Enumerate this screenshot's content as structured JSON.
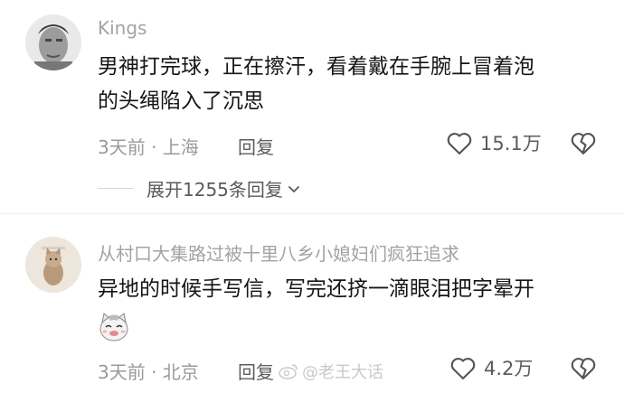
{
  "comments": [
    {
      "username": "Kings",
      "lines": [
        "男神打完球，正在擦汗，看着戴在手腕上冒着泡",
        "的头绳陷入了沉思"
      ],
      "meta": "3天前 · 上海",
      "reply_label": "回复",
      "likes": "15.1万",
      "expand_label": "展开1255条回复"
    },
    {
      "username": "从村口大集路过被十里八乡小媳妇们疯狂追求",
      "lines": [
        "异地的时候手写信，写完还挤一滴眼泪把字晕开"
      ],
      "meta": "3天前 · 北京",
      "reply_label": "回复",
      "likes": "4.2万"
    }
  ],
  "watermark": "@老王大话",
  "icons": {
    "like": "heart-outline-icon",
    "dislike": "broken-heart-icon",
    "expand": "chevron-down-icon",
    "emoji": "cat-smile-emoji-icon"
  }
}
